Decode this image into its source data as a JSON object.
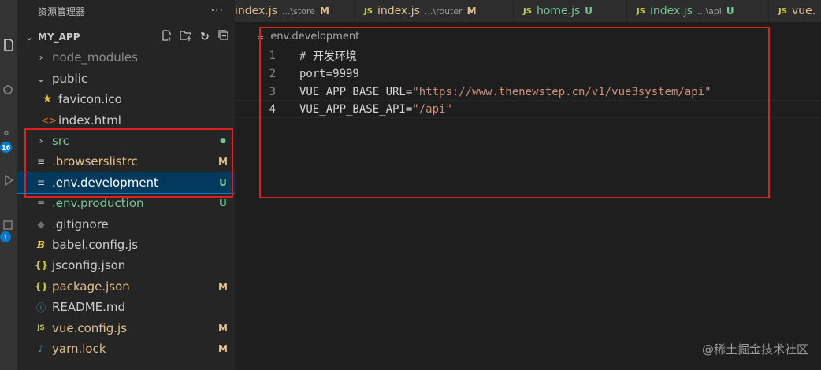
{
  "activity_bar": {
    "icons": [
      "explorer-icon",
      "search-icon",
      "source-control-icon",
      "run-debug-icon",
      "extensions-icon"
    ],
    "source_control_badge": "16",
    "extensions_badge": "1"
  },
  "sidebar": {
    "title": "资源管理器",
    "more_label": "···",
    "section": "MY_APP",
    "actions": [
      "new-file-icon",
      "new-folder-icon",
      "refresh-icon",
      "collapse-icon"
    ],
    "items": [
      {
        "label": "node_modules",
        "badge": ""
      },
      {
        "label": "public",
        "badge": ""
      },
      {
        "label": "favicon.ico",
        "badge": ""
      },
      {
        "label": "index.html",
        "badge": ""
      },
      {
        "label": "src",
        "badge": "●"
      },
      {
        "label": ".browserslistrc",
        "badge": "M"
      },
      {
        "label": ".env.development",
        "badge": "U"
      },
      {
        "label": ".env.production",
        "badge": "U"
      },
      {
        "label": ".gitignore",
        "badge": ""
      },
      {
        "label": "babel.config.js",
        "badge": ""
      },
      {
        "label": "jsconfig.json",
        "badge": ""
      },
      {
        "label": "package.json",
        "badge": "M"
      },
      {
        "label": "README.md",
        "badge": ""
      },
      {
        "label": "vue.config.js",
        "badge": "M"
      },
      {
        "label": "yarn.lock",
        "badge": "M"
      }
    ]
  },
  "tabs": [
    {
      "icon": "",
      "name": "index.js",
      "path": "...\\store",
      "status": "M"
    },
    {
      "icon": "JS",
      "name": "index.js",
      "path": "...\\router",
      "status": "M"
    },
    {
      "icon": "JS",
      "name": "home.js",
      "path": "",
      "status": "U"
    },
    {
      "icon": "JS",
      "name": "index.js",
      "path": "...\\api",
      "status": "U"
    },
    {
      "icon": "JS",
      "name": "vue.",
      "path": "",
      "status": ""
    }
  ],
  "editor": {
    "breadcrumb": ".env.development",
    "lines": [
      {
        "num": "1",
        "text": "# 开发环境",
        "key": "",
        "value": ""
      },
      {
        "num": "2",
        "text": "port=9999",
        "key": "",
        "value": ""
      },
      {
        "num": "3",
        "text": "",
        "key": "VUE_APP_BASE_URL=",
        "value": "\"https://www.thenewstep.cn/v1/vue3system/api\""
      },
      {
        "num": "4",
        "text": "",
        "key": "VUE_APP_BASE_API=",
        "value": "\"/api\""
      }
    ]
  },
  "watermark": "@稀土掘金技术社区",
  "colors": {
    "modified": "#e2c08d",
    "untracked": "#73c991",
    "selection": "#04395e",
    "annotation": "#e02020"
  }
}
